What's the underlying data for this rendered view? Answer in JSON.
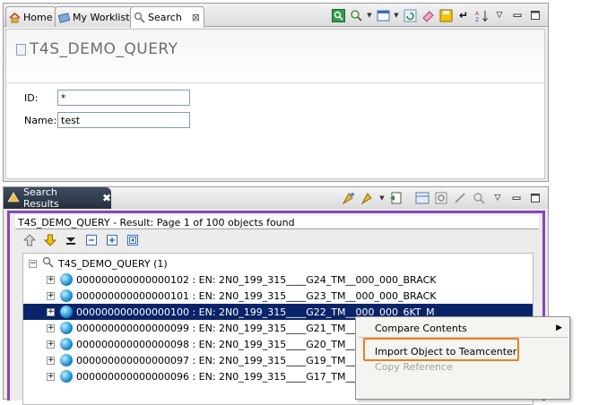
{
  "editor_tabs": [
    {
      "label": "Home",
      "icon": "home-icon"
    },
    {
      "label": "My Worklist",
      "icon": "worklist-icon"
    },
    {
      "label": "Search",
      "icon": "search-icon",
      "active": true
    }
  ],
  "editor_toolbar_icons": [
    "search-execute-icon",
    "search-options-icon",
    "view-select-icon",
    "refresh-icon",
    "clear-icon",
    "save-icon",
    "enter-icon",
    "sort-icon",
    "view-menu-icon",
    "minimize-icon",
    "maximize-icon"
  ],
  "query": {
    "title": "T4S_DEMO_QUERY",
    "fields": [
      {
        "label": "ID:",
        "value": "*"
      },
      {
        "label": "Name:",
        "value": "test"
      }
    ]
  },
  "results_view": {
    "tab_label": "Search Results",
    "close_glyph": "✖",
    "toolbar_icons": [
      "run-icon",
      "run-options-icon",
      "export-icon",
      "table-view-icon",
      "settings-icon",
      "edit-icon",
      "find-icon",
      "view-menu-icon",
      "minimize-icon",
      "maximize-icon"
    ],
    "header": "T4S_DEMO_QUERY - Result: Page 1 of 100 objects found",
    "nav_icons": [
      "previous-page-icon",
      "next-page-icon",
      "last-page-icon",
      "collapse-all-icon",
      "expand-icon",
      "expand-all-icon"
    ],
    "tree": {
      "root": "T4S_DEMO_QUERY (1)",
      "rows": [
        {
          "text": "000000000000000102 : EN: 2N0_199_315____G24_TM__000_000_BRACK",
          "selected": false
        },
        {
          "text": "000000000000000101 : EN: 2N0_199_315____G23_TM__000_000_BRACK",
          "selected": false
        },
        {
          "text": "000000000000000100 : EN: 2N0_199_315____G22_TM__000_000_6KT_M",
          "selected": true
        },
        {
          "text": "000000000000000099 : EN: 2N0_199_315____G21_TM__000_0",
          "selected": false
        },
        {
          "text": "000000000000000098 : EN: 2N0_199_315____G20_TM__000_0",
          "selected": false
        },
        {
          "text": "000000000000000097 : EN: 2N0_199_315____G19_TM__000_0",
          "selected": false
        },
        {
          "text": "000000000000000096 : EN: 2N0_199_315____G17_TM__000_0",
          "selected": false
        }
      ]
    }
  },
  "context_menu": {
    "items": [
      {
        "label": "Compare Contents",
        "submenu": true,
        "enabled": true
      },
      {
        "label": "Import Object to Teamcenter",
        "submenu": false,
        "enabled": true,
        "highlighted": true
      },
      {
        "label": "Copy Reference",
        "submenu": false,
        "enabled": false
      }
    ],
    "submenu_glyph": "▶"
  },
  "colors": {
    "selection": "#0a246a",
    "view_border": "#8a45b8",
    "highlight_outline": "#ee7d1f"
  }
}
